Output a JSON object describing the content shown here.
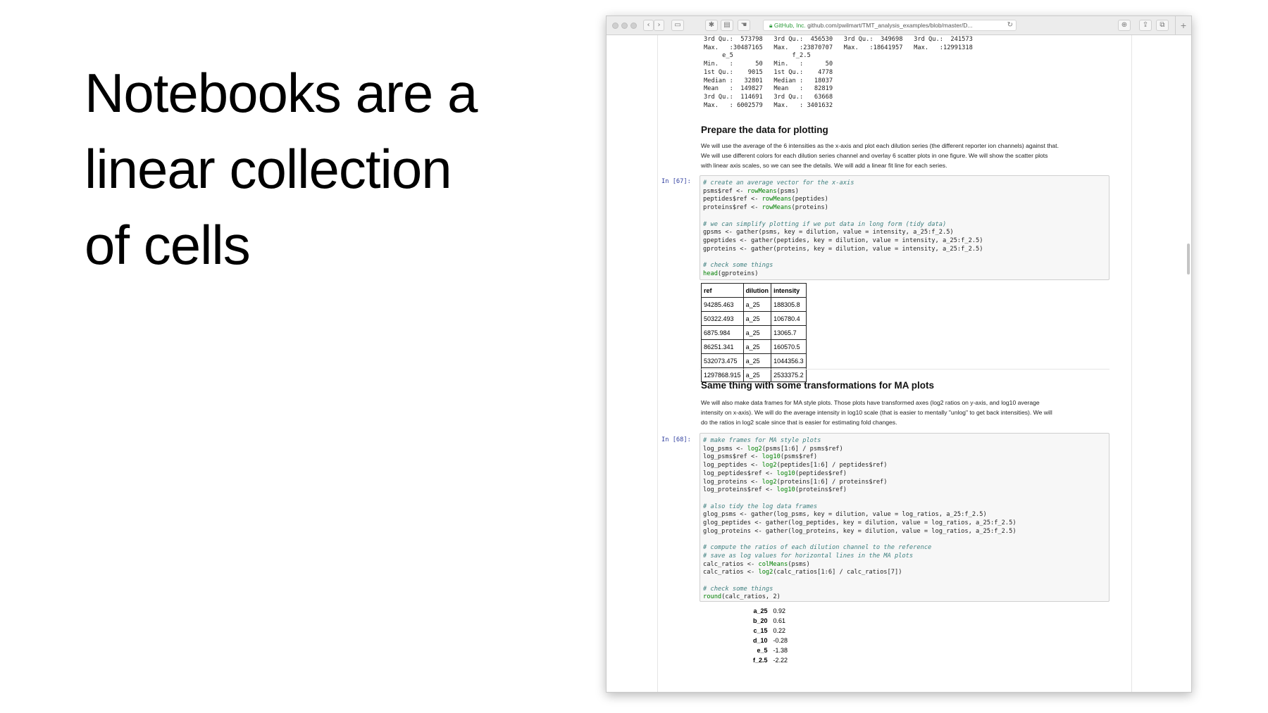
{
  "slide": {
    "title_lines": [
      "Notebooks are a",
      "linear collection",
      "of cells"
    ]
  },
  "browser": {
    "url_org": "GitHub, Inc.",
    "url_text": "github.com/pwilmart/TMT_analysis_examples/blob/master/D..."
  },
  "summary_output": "3rd Qu.:  573798   3rd Qu.:  456530   3rd Qu.:  349698   3rd Qu.:  241573\nMax.   :30487165   Max.   :23870707   Max.   :18641957   Max.   :12991318\n     e_5                f_2.5\nMin.   :      50   Min.   :      50\n1st Qu.:    9015   1st Qu.:    4778\nMedian :   32801   Median :   18037\nMean   :  149827   Mean   :   82819\n3rd Qu.:  114691   3rd Qu.:   63668\nMax.   : 6002579   Max.   : 3401632",
  "section1": {
    "heading": "Prepare the data for plotting",
    "lines": [
      "We will use the average of the 6 intensities as the x-axis and plot each dilution series (the different reporter ion channels) against that.",
      "We will use different colors for each dilution series channel and overlay 6 scatter plots in one figure. We will show the scatter plots",
      "with linear axis scales, so we can see the details. We will add a linear fit line for each series."
    ]
  },
  "cell67": {
    "prompt": "In [67]:",
    "code": [
      {
        "t": "# create an average vector for the x-axis",
        "k": "cm"
      },
      {
        "t": "psms$ref <- ",
        "k": "",
        "fn": "rowMeans",
        "rest": "(psms)"
      },
      {
        "t": "peptides$ref <- ",
        "k": "",
        "fn": "rowMeans",
        "rest": "(peptides)"
      },
      {
        "t": "proteins$ref <- ",
        "k": "",
        "fn": "rowMeans",
        "rest": "(proteins)"
      },
      {
        "t": "",
        "k": ""
      },
      {
        "t": "# we can simplify plotting if we put data in long form (tidy data)",
        "k": "cm"
      },
      {
        "t": "gpsms <- gather(psms, key = dilution, value = intensity, a_25:f_2.5)",
        "k": ""
      },
      {
        "t": "gpeptides <- gather(peptides, key = dilution, value = intensity, a_25:f_2.5)",
        "k": ""
      },
      {
        "t": "gproteins <- gather(proteins, key = dilution, value = intensity, a_25:f_2.5)",
        "k": ""
      },
      {
        "t": "",
        "k": ""
      },
      {
        "t": "# check some things",
        "k": "cm"
      },
      {
        "t": "",
        "k": "",
        "fn": "head",
        "rest": "(gproteins)"
      }
    ],
    "table": {
      "headers": [
        "ref",
        "dilution",
        "intensity"
      ],
      "rows": [
        [
          "94285.463",
          "a_25",
          "188305.8"
        ],
        [
          "50322.493",
          "a_25",
          "106780.4"
        ],
        [
          "6875.984",
          "a_25",
          "13065.7"
        ],
        [
          "86251.341",
          "a_25",
          "160570.5"
        ],
        [
          "532073.475",
          "a_25",
          "1044356.3"
        ],
        [
          "1297868.915",
          "a_25",
          "2533375.2"
        ]
      ]
    }
  },
  "section2": {
    "heading": "Same thing with some transformations for MA plots",
    "lines": [
      "We will also make data frames for MA style plots. Those plots have transformed axes (log2 ratios on y-axis, and log10 average",
      "intensity on x-axis). We will do the average intensity in log10 scale (that is easier to mentally \"unlog\" to get back intensities). We will",
      "do the ratios in log2 scale since that is easier for estimating fold changes."
    ]
  },
  "cell68": {
    "prompt": "In [68]:",
    "code": [
      {
        "t": "# make frames for MA style plots",
        "k": "cm"
      },
      {
        "t": "log_psms <- ",
        "k": "",
        "fn": "log2",
        "rest": "(psms[1:6] / psms$ref)"
      },
      {
        "t": "log_psms$ref <- ",
        "k": "",
        "fn": "log10",
        "rest": "(psms$ref)"
      },
      {
        "t": "log_peptides <- ",
        "k": "",
        "fn": "log2",
        "rest": "(peptides[1:6] / peptides$ref)"
      },
      {
        "t": "log_peptides$ref <- ",
        "k": "",
        "fn": "log10",
        "rest": "(peptides$ref)"
      },
      {
        "t": "log_proteins <- ",
        "k": "",
        "fn": "log2",
        "rest": "(proteins[1:6] / proteins$ref)"
      },
      {
        "t": "log_proteins$ref <- ",
        "k": "",
        "fn": "log10",
        "rest": "(proteins$ref)"
      },
      {
        "t": "",
        "k": ""
      },
      {
        "t": "# also tidy the log data frames",
        "k": "cm"
      },
      {
        "t": "glog_psms <- gather(log_psms, key = dilution, value = log_ratios, a_25:f_2.5)",
        "k": ""
      },
      {
        "t": "glog_peptides <- gather(log_peptides, key = dilution, value = log_ratios, a_25:f_2.5)",
        "k": ""
      },
      {
        "t": "glog_proteins <- gather(log_proteins, key = dilution, value = log_ratios, a_25:f_2.5)",
        "k": ""
      },
      {
        "t": "",
        "k": ""
      },
      {
        "t": "# compute the ratios of each dilution channel to the reference",
        "k": "cm"
      },
      {
        "t": "# save as log values for horizontal lines in the MA plots",
        "k": "cm"
      },
      {
        "t": "calc_ratios <- ",
        "k": "",
        "fn": "colMeans",
        "rest": "(psms)"
      },
      {
        "t": "calc_ratios <- ",
        "k": "",
        "fn": "log2",
        "rest": "(calc_ratios[1:6] / calc_ratios[7])"
      },
      {
        "t": "",
        "k": ""
      },
      {
        "t": "# check some things",
        "k": "cm"
      },
      {
        "t": "",
        "k": "",
        "fn": "round",
        "rest": "(calc_ratios, 2)"
      }
    ],
    "ratios": [
      {
        "name": "a_25",
        "value": "0.92"
      },
      {
        "name": "b_20",
        "value": "0.61"
      },
      {
        "name": "c_15",
        "value": "0.22"
      },
      {
        "name": "d_10",
        "value": "-0.28"
      },
      {
        "name": "e_5",
        "value": "-1.38"
      },
      {
        "name": "f_2.5",
        "value": "-2.22"
      }
    ]
  }
}
